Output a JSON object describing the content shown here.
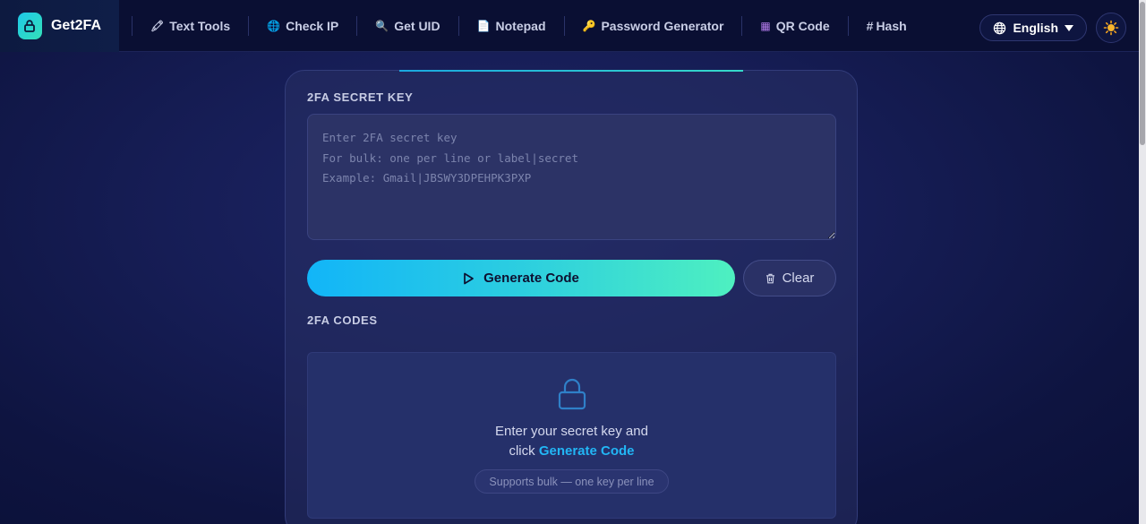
{
  "brand": {
    "name": "Get2FA",
    "icon": "lock-icon"
  },
  "nav": [
    {
      "label": "Text Tools",
      "icon": "pencil-icon",
      "glyph": "🖍"
    },
    {
      "label": "Check IP",
      "icon": "globe-icon",
      "glyph": "🌐"
    },
    {
      "label": "Get UID",
      "icon": "magnifier-icon",
      "glyph": "🔍"
    },
    {
      "label": "Notepad",
      "icon": "notepad-icon",
      "glyph": "📄"
    },
    {
      "label": "Password Generator",
      "icon": "key-icon",
      "glyph": "🔑"
    },
    {
      "label": "QR Code",
      "icon": "qr-icon",
      "glyph": "▦"
    },
    {
      "label": "Hash",
      "icon": "hash-icon",
      "glyph": "#"
    }
  ],
  "language": {
    "label": "English",
    "icon": "globe-icon"
  },
  "theme_toggle": {
    "icon": "sun-icon"
  },
  "secret": {
    "label": "2FA SECRET KEY",
    "placeholder": "Enter 2FA secret key\nFor bulk: one per line or label|secret\nExample: Gmail|JBSWY3DPEHPK3PXP",
    "value": ""
  },
  "actions": {
    "generate_label": "Generate Code",
    "clear_label": "Clear"
  },
  "codes": {
    "label": "2FA CODES",
    "empty_line1": "Enter your secret key and",
    "empty_line2_prefix": "click ",
    "empty_link": "Generate Code",
    "hint": "Supports bulk — one key per line"
  },
  "colors": {
    "accent_start": "#12b5f8",
    "accent_end": "#4ef0c0",
    "link": "#22b6f5",
    "background": "#161d55"
  }
}
